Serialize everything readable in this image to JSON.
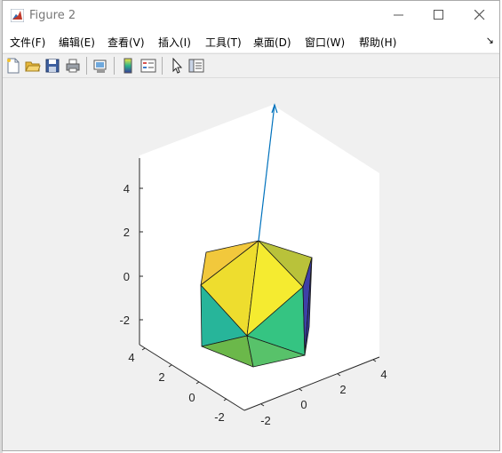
{
  "window": {
    "title": "Figure 2"
  },
  "menu": [
    {
      "label": "文件(F)"
    },
    {
      "label": "编辑(E)"
    },
    {
      "label": "查看(V)"
    },
    {
      "label": "插入(I)"
    },
    {
      "label": "工具(T)"
    },
    {
      "label": "桌面(D)"
    },
    {
      "label": "窗口(W)"
    },
    {
      "label": "帮助(H)"
    }
  ],
  "menu_dock_symbol": "↘",
  "toolbar": {
    "icons": [
      "new-figure-icon",
      "open-file-icon",
      "save-icon",
      "print-icon",
      "link-plot-icon",
      "colorbar-icon",
      "legend-icon",
      "pointer-icon",
      "property-inspector-icon"
    ]
  },
  "axes": {
    "z_ticks": [
      "4",
      "2",
      "0",
      "-2"
    ],
    "y_ticks": [
      "4",
      "2",
      "0",
      "-2"
    ],
    "x_ticks": [
      "-2",
      "0",
      "2",
      "4"
    ]
  },
  "colors": {
    "figure_background": "#f0f0f0",
    "axes_background": "#ffffff",
    "arrow": "#0072bd"
  }
}
